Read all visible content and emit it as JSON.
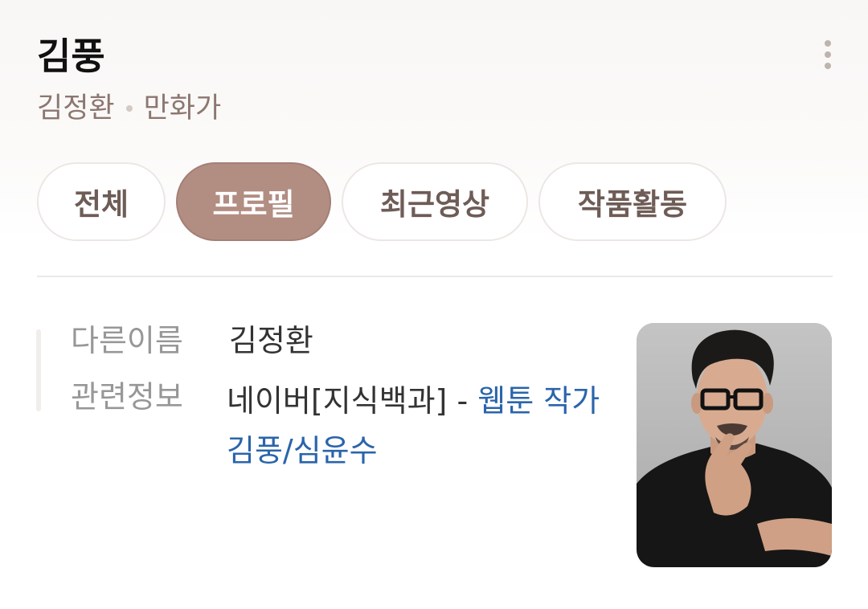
{
  "profile": {
    "name": "김풍",
    "real_name": "김정환",
    "occupation": "만화가"
  },
  "tabs": [
    {
      "label": "전체",
      "active": false
    },
    {
      "label": "프로필",
      "active": true
    },
    {
      "label": "최근영상",
      "active": false
    },
    {
      "label": "작품활동",
      "active": false
    }
  ],
  "info": {
    "other_name_label": "다른이름",
    "other_name_value": "김정환",
    "related_label": "관련정보",
    "related_source": "네이버[지식백과]",
    "related_separator": " - ",
    "related_link_text": "웹툰 작가 김풍/심윤수"
  },
  "icons": {
    "more": "more-vertical-icon"
  },
  "colors": {
    "accent": "#b28d82",
    "link": "#2a64ab",
    "subtitle": "#8c7770"
  }
}
